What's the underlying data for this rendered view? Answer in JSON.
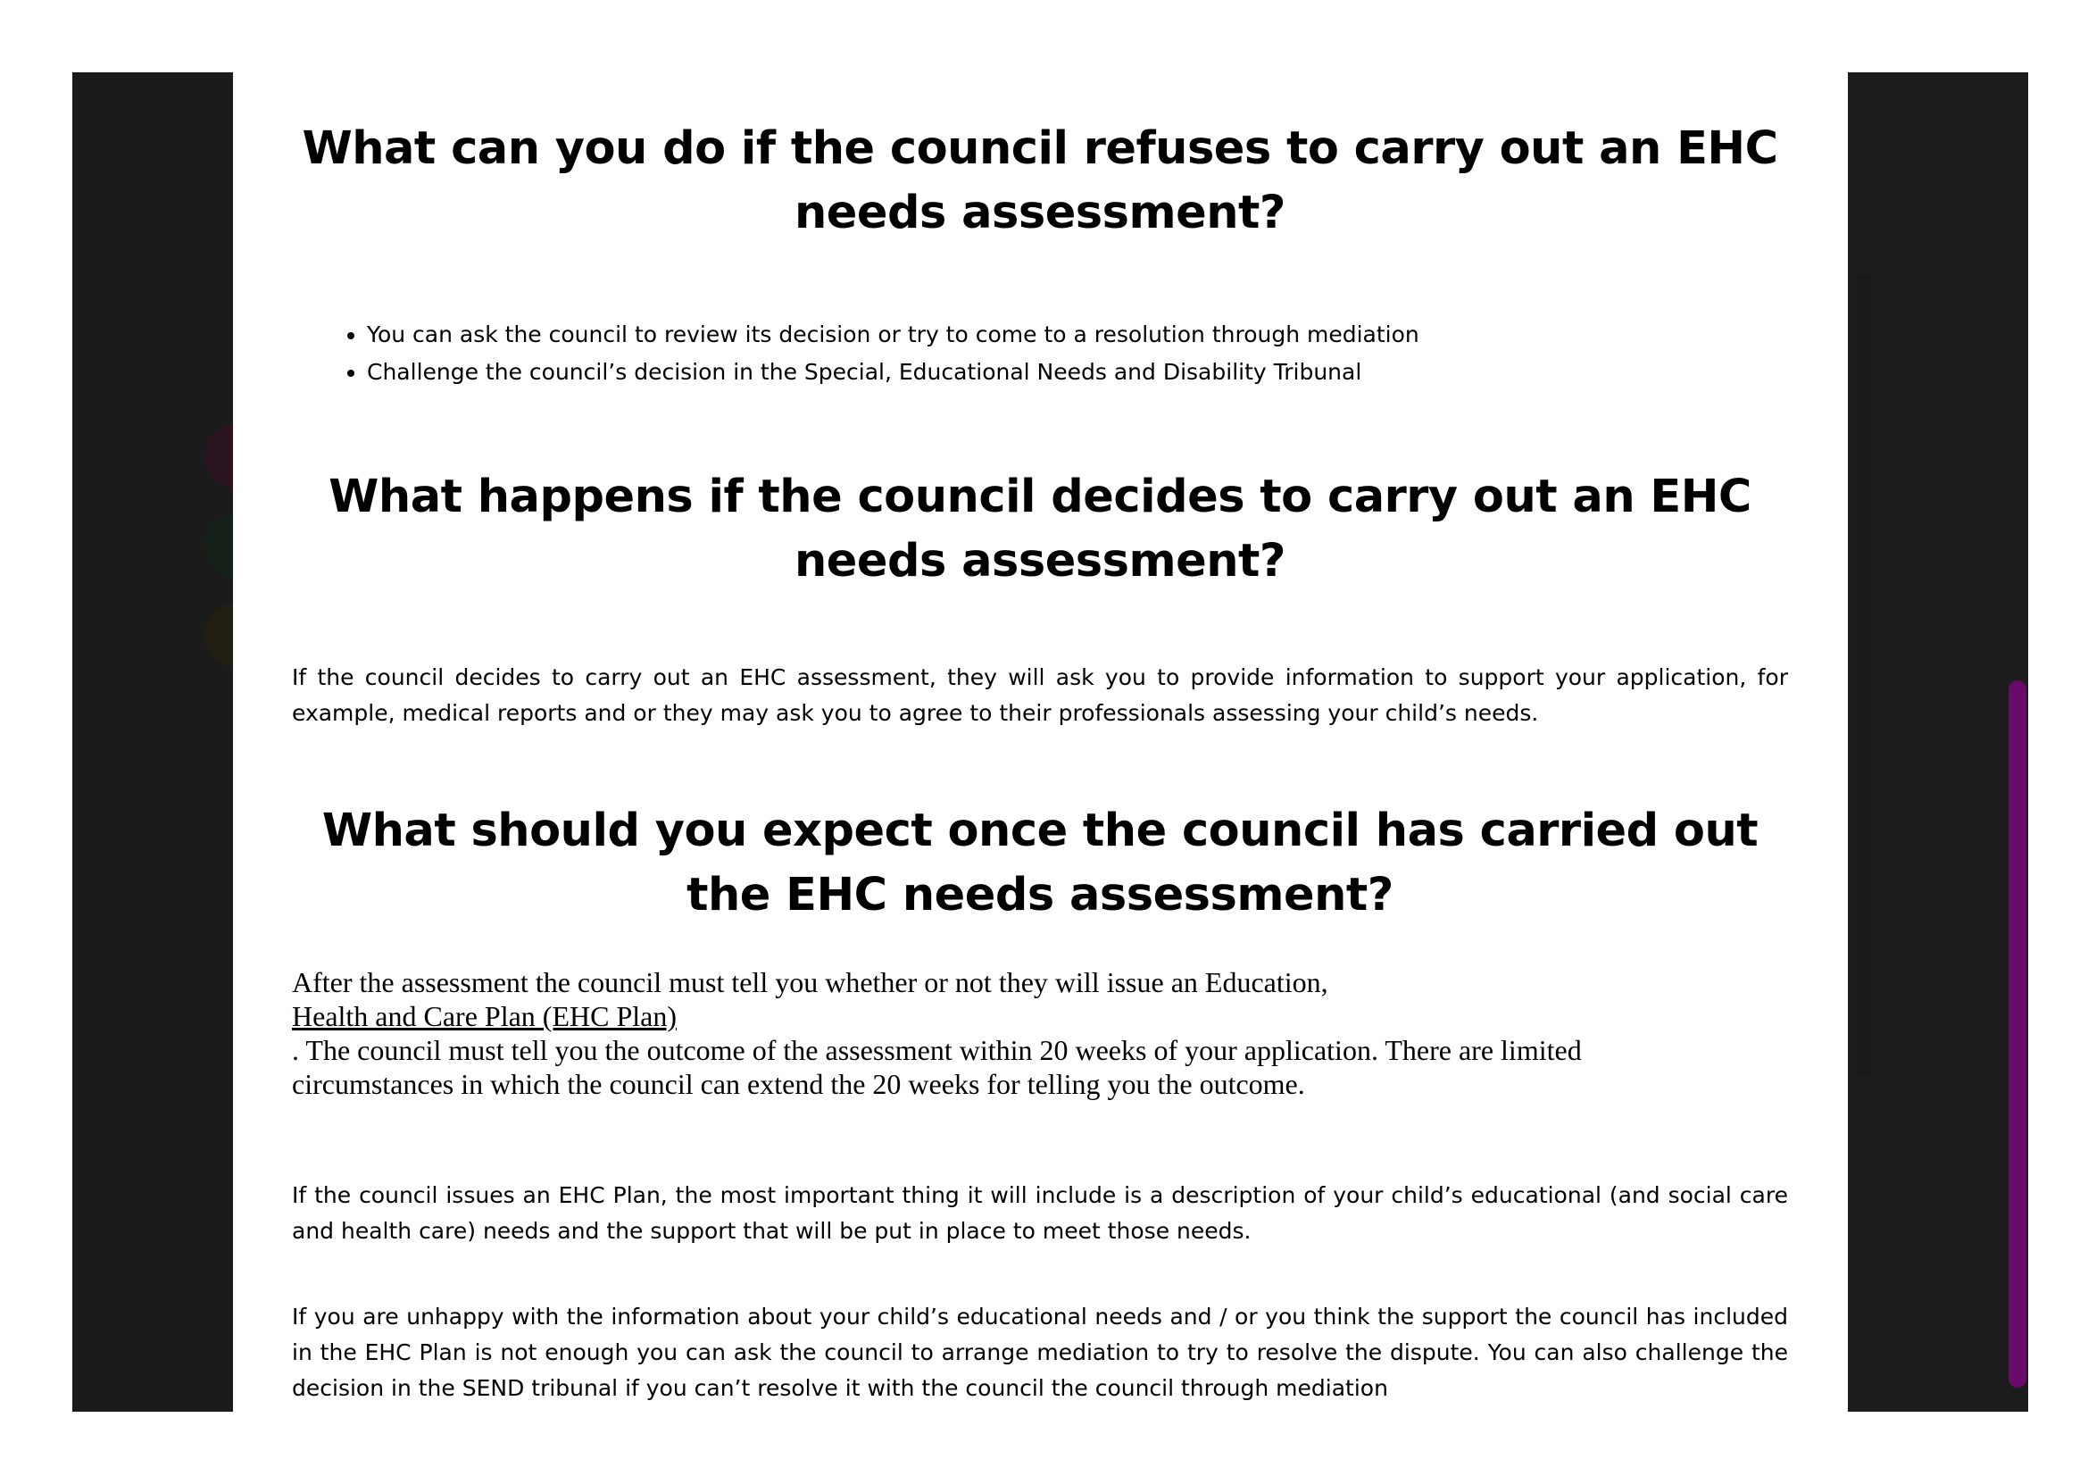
{
  "section1": {
    "heading": "What can you do if the council refuses to carry out an EHC needs assessment?",
    "bullets": [
      "You can ask the council to review its decision or try to come to a resolution through mediation",
      "Challenge the council’s decision in the Special, Educational Needs and Disability Tribunal"
    ]
  },
  "section2": {
    "heading": "What happens if the council decides to carry out an EHC needs assessment?",
    "paragraph": "If the council decides to carry out an EHC assessment, they will ask you to provide information to support your application, for example, medical reports and or they may ask you to agree to their professionals assessing your child’s needs."
  },
  "section3": {
    "heading": "What should you expect once the council has carried out the EHC needs assessment?",
    "serif_line1": "After the assessment the council must tell you whether or not they will issue an Education,",
    "link_text": "Health and Care Plan (EHC Plan)",
    "serif_line2": ". The council must tell you the outcome of the assessment within 20 weeks of your application. There are limited circumstances in which the council can extend the 20 weeks for telling you the outcome.",
    "paragraph1": "If the council issues an EHC Plan, the most important thing it will include is a description of your child’s educational (and social care and health care) needs and the support that will be put in place to meet those needs.",
    "paragraph2": "If you are unhappy with the information about your child’s educational needs and / or you think the support the council has included in the EHC Plan is not enough you can ask the council to arrange mediation to try to resolve the dispute. You can also challenge the decision in the SEND tribunal if you can’t resolve it with the council the council through mediation"
  },
  "colors": {
    "side_panel": "#1b1b1b",
    "scroll_thumb": "#6a0a6a"
  }
}
